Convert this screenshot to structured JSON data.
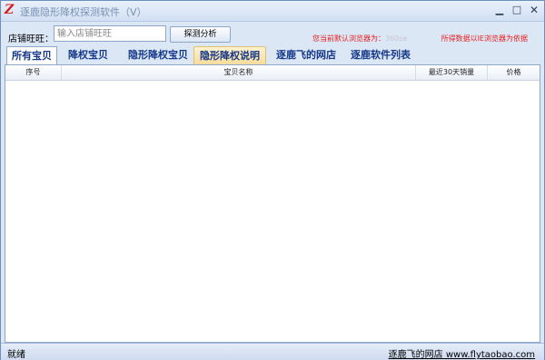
{
  "window": {
    "title": "逐鹿隐形降权探测软件（V）",
    "minimize": "▁",
    "maximize": "□",
    "close": "✕"
  },
  "toolbar": {
    "shop_label": "店铺旺旺：",
    "shop_placeholder": "输入店铺旺旺",
    "shop_value": "",
    "detect_button": "探测分析",
    "browser_note_prefix": "您当前默认浏览器为：",
    "browser_note_value": "360se",
    "data_note": "所得数据以IE浏览器为依据"
  },
  "tabs": [
    {
      "label": "所有宝贝",
      "state": "active"
    },
    {
      "label": "降权宝贝",
      "state": "normal"
    },
    {
      "label": "隐形降权宝贝",
      "state": "normal"
    },
    {
      "label": "隐形降权说明",
      "state": "hover"
    },
    {
      "label": "逐鹿飞的网店",
      "state": "normal"
    },
    {
      "label": "逐鹿软件列表",
      "state": "normal"
    }
  ],
  "grid": {
    "columns": [
      "序号",
      "宝贝名称",
      "最近30天销量",
      "价格"
    ],
    "rows": []
  },
  "status": {
    "text": "就绪",
    "link": "逐鹿飞的网店 www.flytaobao.com"
  },
  "colors": {
    "accent": "#15388a",
    "warning_text": "#e82020",
    "window_bg": "#dce7f5"
  }
}
